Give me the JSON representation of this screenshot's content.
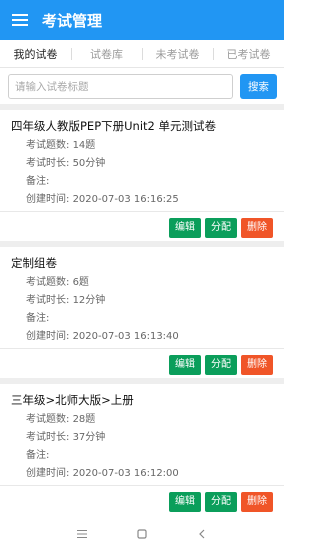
{
  "appbar": {
    "title": "考试管理",
    "menu_icon": "hamburger-menu-icon"
  },
  "tabs": [
    {
      "label": "我的试卷",
      "active": true
    },
    {
      "label": "试卷库",
      "active": false
    },
    {
      "label": "未考试卷",
      "active": false
    },
    {
      "label": "已考试卷",
      "active": false
    }
  ],
  "search": {
    "placeholder": "请输入试卷标题",
    "button_label": "搜索"
  },
  "labels": {
    "count": "考试题数:",
    "duration": "考试时长:",
    "remark": "备注:",
    "created": "创建时间:"
  },
  "actions": {
    "edit": "编辑",
    "assign": "分配",
    "delete": "删除"
  },
  "papers": [
    {
      "title": "四年级人教版PEP下册Unit2 单元测试卷",
      "count": "14题",
      "duration": "50分钟",
      "remark": "",
      "created": "2020-07-03 16:16:25"
    },
    {
      "title": "定制组卷",
      "count": "6题",
      "duration": "12分钟",
      "remark": "",
      "created": "2020-07-03 16:13:40"
    },
    {
      "title": "三年级>北师大版>上册",
      "count": "28题",
      "duration": "37分钟",
      "remark": "",
      "created": "2020-07-03 16:12:00"
    }
  ],
  "colors": {
    "primary": "#2196f3",
    "green": "#0b9e5b",
    "red": "#f05528"
  }
}
